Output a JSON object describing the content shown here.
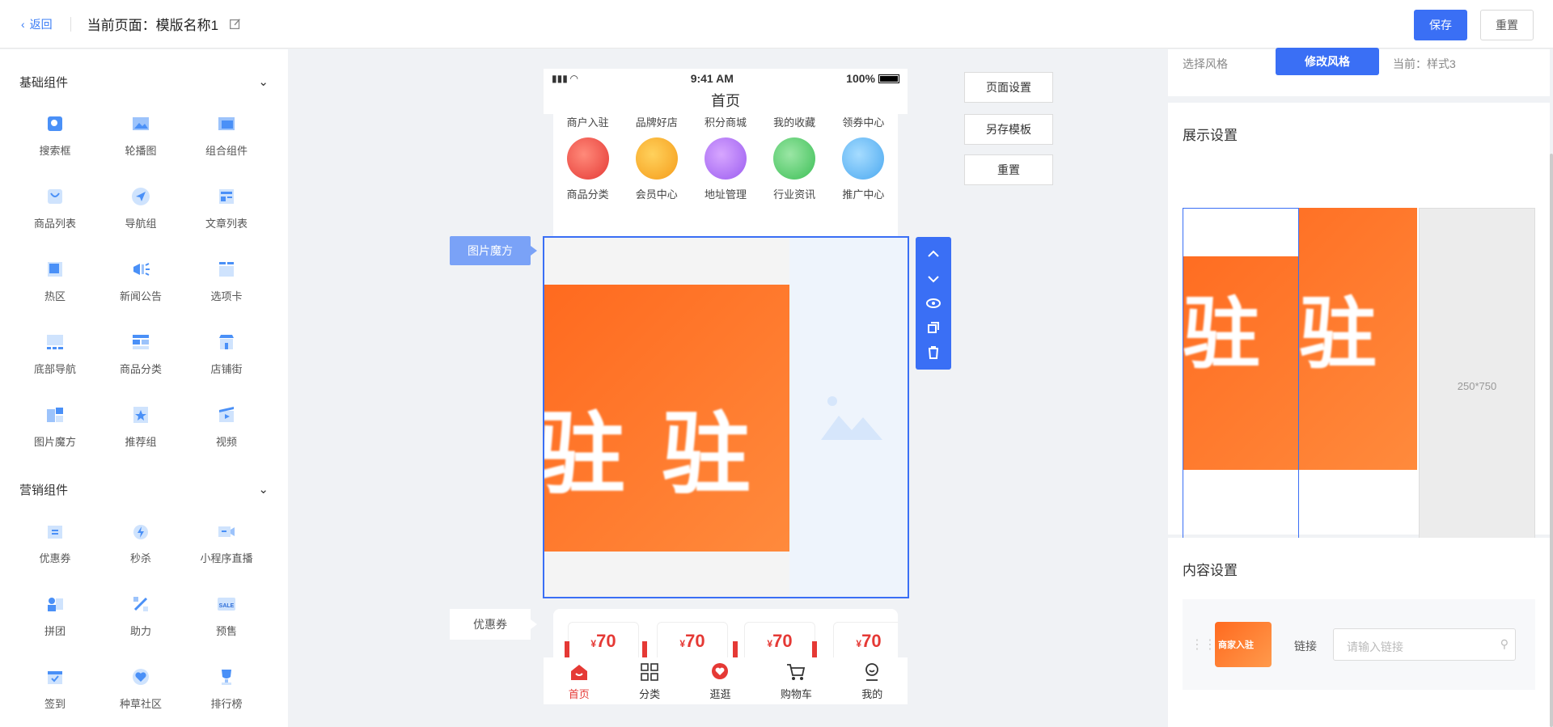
{
  "topbar": {
    "back_label": "返回",
    "page_title": "当前页面：模版名称1",
    "save_label": "保存",
    "reset_label": "重置"
  },
  "left": {
    "basic_title": "基础组件",
    "basic": [
      "搜索框",
      "轮播图",
      "组合组件",
      "商品列表",
      "导航组",
      "文章列表",
      "热区",
      "新闻公告",
      "选项卡",
      "底部导航",
      "商品分类",
      "店铺街",
      "图片魔方",
      "推荐组",
      "视频"
    ],
    "marketing_title": "营销组件",
    "marketing": [
      "优惠券",
      "秒杀",
      "小程序直播",
      "拼团",
      "助力",
      "预售",
      "签到",
      "种草社区",
      "排行榜"
    ]
  },
  "phone": {
    "time": "9:41 AM",
    "battery": "100%",
    "title": "首页",
    "nav_row1": [
      "商户入驻",
      "品牌好店",
      "积分商城",
      "我的收藏",
      "领券中心"
    ],
    "nav_row2": [
      "商品分类",
      "会员中心",
      "地址管理",
      "行业资讯",
      "推广中心"
    ],
    "cube_tag": "图片魔方",
    "cube_char": "驻",
    "coupon_tag": "优惠券",
    "coupon_value": "70",
    "coupon_currency": "¥",
    "tabs": [
      "首页",
      "分类",
      "逛逛",
      "购物车",
      "我的"
    ]
  },
  "side_buttons": [
    "页面设置",
    "另存模板",
    "重置"
  ],
  "right": {
    "style_label": "选择风格",
    "style_button": "修改风格",
    "style_current": "当前：样式3",
    "display_title": "展示设置",
    "placeholder_size": "250*750",
    "content_title": "内容设置",
    "link_label": "链接",
    "link_placeholder": "请输入链接",
    "thumb_text": "商家入驻"
  },
  "colors": {
    "accent": "#3a6ff5",
    "orange": "#ff6a1f",
    "coupon_red": "#e53935"
  }
}
